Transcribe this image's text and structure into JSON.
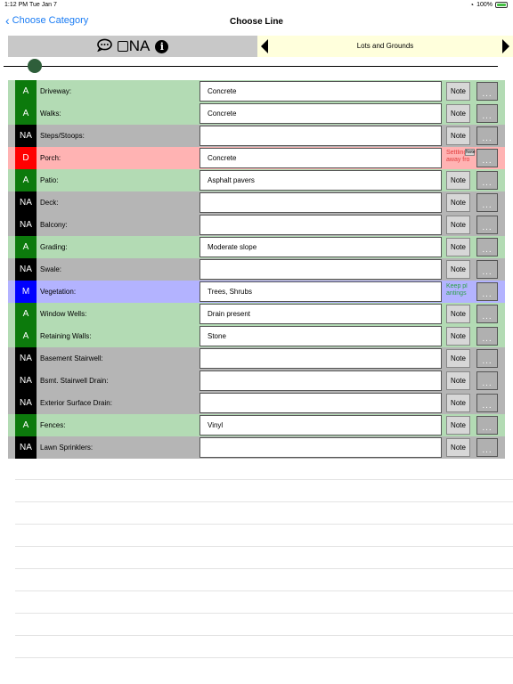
{
  "status_bar": {
    "time": "1:12 PM",
    "date": "Tue Jan 7",
    "battery": "100%"
  },
  "nav": {
    "back_label": "Choose Category",
    "title": "Choose Line"
  },
  "toolbar": {
    "na_label": "NA"
  },
  "category": {
    "label": "Lots and Grounds"
  },
  "colors": {
    "A_bg": "#b3dbb4",
    "A_badge": "#0c7a0c",
    "NA_bg": "#b5b5b5",
    "NA_badge": "#000000",
    "D_bg": "#ffb3b3",
    "D_badge": "#ff0000",
    "M_bg": "#b3b3ff",
    "M_badge": "#0000ff"
  },
  "rows": [
    {
      "status": "A",
      "label": "Driveway:",
      "value": "Concrete",
      "note": "Note"
    },
    {
      "status": "A",
      "label": "Walks:",
      "value": "Concrete",
      "note": "Note"
    },
    {
      "status": "NA",
      "label": "Steps/Stoops:",
      "value": "",
      "note": "Note"
    },
    {
      "status": "D",
      "label": "Porch:",
      "value": "Concrete",
      "note_text": "Settling away fro",
      "note_text_color": "#e23d3d",
      "note_mini": "Note"
    },
    {
      "status": "A",
      "label": "Patio:",
      "value": "Asphalt pavers",
      "note": "Note"
    },
    {
      "status": "NA",
      "label": "Deck:",
      "value": "",
      "note": "Note"
    },
    {
      "status": "NA",
      "label": "Balcony:",
      "value": "",
      "note": "Note"
    },
    {
      "status": "A",
      "label": "Grading:",
      "value": "Moderate slope",
      "note": "Note"
    },
    {
      "status": "NA",
      "label": "Swale:",
      "value": "",
      "note": "Note"
    },
    {
      "status": "M",
      "label": "Vegetation:",
      "value": "Trees, Shrubs",
      "note_text": "Keep pl antings",
      "note_text_color": "#2fa04a"
    },
    {
      "status": "A",
      "label": "Window Wells:",
      "value": "Drain present",
      "note": "Note"
    },
    {
      "status": "A",
      "label": "Retaining Walls:",
      "value": "Stone",
      "note": "Note"
    },
    {
      "status": "NA",
      "label": "Basement Stairwell:",
      "value": "",
      "note": "Note"
    },
    {
      "status": "NA",
      "label": "Bsmt. Stairwell Drain:",
      "value": "",
      "note": "Note"
    },
    {
      "status": "NA",
      "label": "Exterior Surface Drain:",
      "value": "",
      "note": "Note"
    },
    {
      "status": "A",
      "label": "Fences:",
      "value": "Vinyl",
      "note": "Note"
    },
    {
      "status": "NA",
      "label": "Lawn Sprinklers:",
      "value": "",
      "note": "Note"
    }
  ],
  "more_label": "...",
  "empty_line_count": 9
}
